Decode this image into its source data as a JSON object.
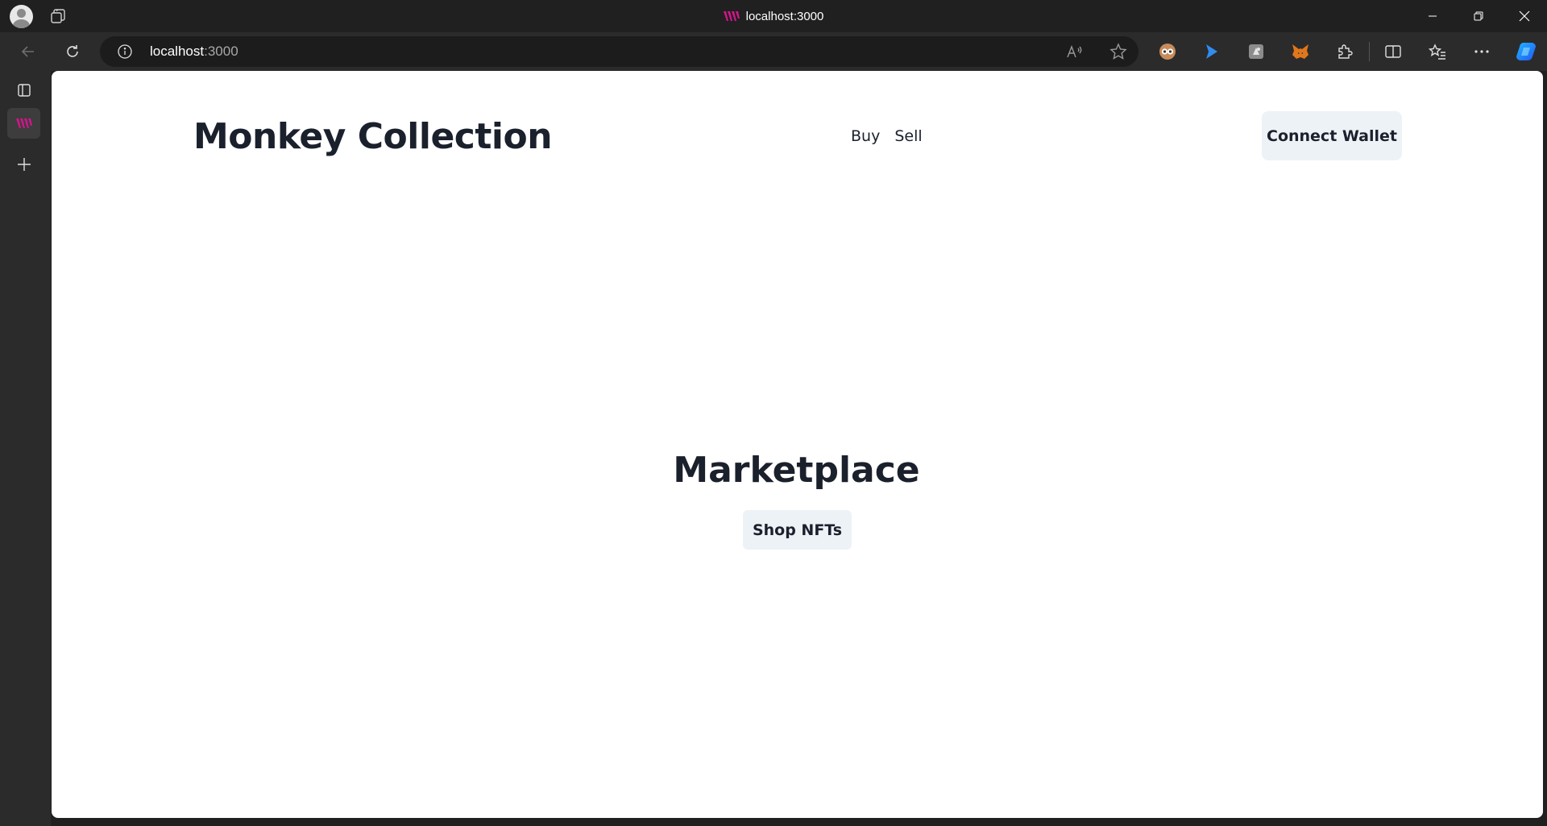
{
  "browser": {
    "window_title": "localhost:3000",
    "address": {
      "host": "localhost",
      "port": ":3000"
    },
    "icons": {
      "profile": "profile-avatar-icon",
      "workspaces": "workspaces-icon",
      "favicon": "site-favicon-icon",
      "back": "back-arrow-icon",
      "refresh": "refresh-icon",
      "info": "site-info-icon",
      "read_aloud": "read-aloud-icon",
      "favorite": "star-icon",
      "extensions": [
        "owl-extension-icon",
        "cursor-extension-icon",
        "gray-extension-icon",
        "metamask-fox-icon"
      ],
      "puzzle": "extensions-puzzle-icon",
      "split": "split-screen-icon",
      "collections": "favorites-list-icon",
      "more": "more-dots-icon",
      "copilot": "copilot-icon"
    },
    "colors": {
      "chrome_dark": "#202020",
      "toolbar": "#2b2b2b",
      "favicon_magenta": "#d4148c"
    }
  },
  "site": {
    "title": "Monkey Collection",
    "nav": {
      "buy": "Buy",
      "sell": "Sell"
    },
    "connect_wallet": "Connect Wallet",
    "hero": {
      "title": "Marketplace",
      "cta": "Shop NFTs"
    },
    "colors": {
      "text": "#1a202c",
      "button_bg": "#edf2f7",
      "page_bg": "#ffffff"
    }
  }
}
